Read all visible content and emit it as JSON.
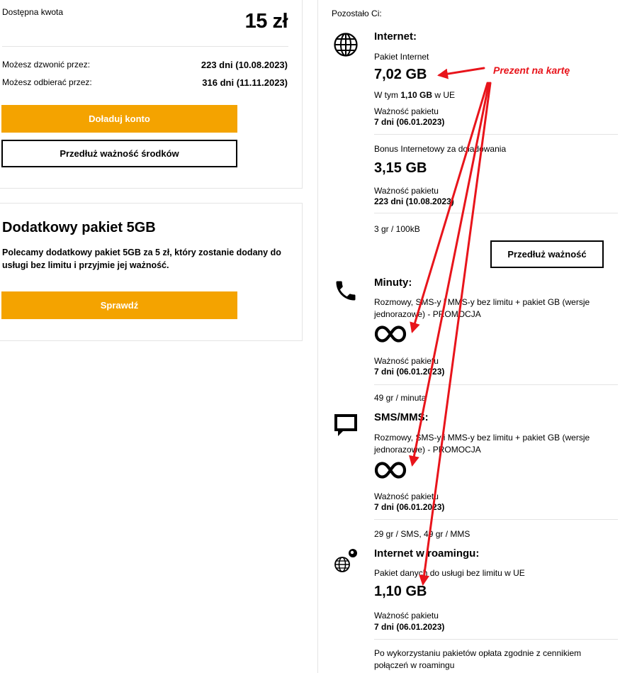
{
  "balance": {
    "label": "Dostępna kwota",
    "amount": "15 zł",
    "rows": [
      {
        "label": "Możesz dzwonić przez:",
        "value": "223 dni (10.08.2023)"
      },
      {
        "label": "Możesz odbierać przez:",
        "value": "316 dni (11.11.2023)"
      }
    ],
    "topup_label": "Doładuj konto",
    "extend_label": "Przedłuż ważność środków"
  },
  "promo": {
    "title": "Dodatkowy pakiet 5GB",
    "desc_line1": "Polecamy dodatkowy pakiet 5GB za 5 zł, który zostanie dodany do",
    "desc_line2": "usługi bez limitu i przyjmie jej ważność.",
    "check_label": "Sprawdź"
  },
  "remaining": {
    "label": "Pozostało Ci:",
    "internet": {
      "title": "Internet:",
      "pkg_name": "Pakiet Internet",
      "pkg_amount": "7,02 GB",
      "eu_prefix": "W tym",
      "eu_value": "1,10 GB",
      "eu_suffix": "w UE",
      "validity_label": "Ważność pakietu",
      "validity_value": "7 dni (06.01.2023)",
      "bonus_name": "Bonus Internetowy za doładowania",
      "bonus_amount": "3,15 GB",
      "bonus_validity_label": "Ważność pakietu",
      "bonus_validity_value": "223 dni (10.08.2023)",
      "rate": "3 gr / 100kB",
      "extend_label": "Przedłuż ważność"
    },
    "minutes": {
      "title": "Minuty:",
      "desc_line1": "Rozmowy, SMS-y i MMS-y bez limitu + pakiet GB (wersje",
      "desc_line2": "jednorazowe) - PROMOCJA",
      "validity_label": "Ważność pakietu",
      "validity_value": "7 dni (06.01.2023)",
      "rate": "49 gr / minuta"
    },
    "sms": {
      "title": "SMS/MMS:",
      "desc_line1": "Rozmowy, SMS-y i MMS-y bez limitu + pakiet GB (wersje",
      "desc_line2": "jednorazowe) - PROMOCJA",
      "validity_label": "Ważność pakietu",
      "validity_value": "7 dni (06.01.2023)",
      "rate": "29 gr / SMS, 49 gr / MMS"
    },
    "roaming": {
      "title": "Internet w roamingu:",
      "pkg_name": "Pakiet danych do usługi bez limitu w UE",
      "pkg_amount": "1,10 GB",
      "validity_label": "Ważność pakietu",
      "validity_value": "7 dni (06.01.2023)",
      "note_line1": "Po wykorzystaniu pakietów opłata zgodnie z cennikiem",
      "note_line2": "połączeń w roamingu"
    }
  },
  "annotation": {
    "text": "Prezent na kartę",
    "color": "#e8141b"
  },
  "colors": {
    "accent_orange": "#f4a300",
    "divider": "#e4e4e4"
  },
  "icons": [
    "globe-icon",
    "phone-icon",
    "infinity-icon",
    "message-icon",
    "roaming-globe-icon"
  ]
}
